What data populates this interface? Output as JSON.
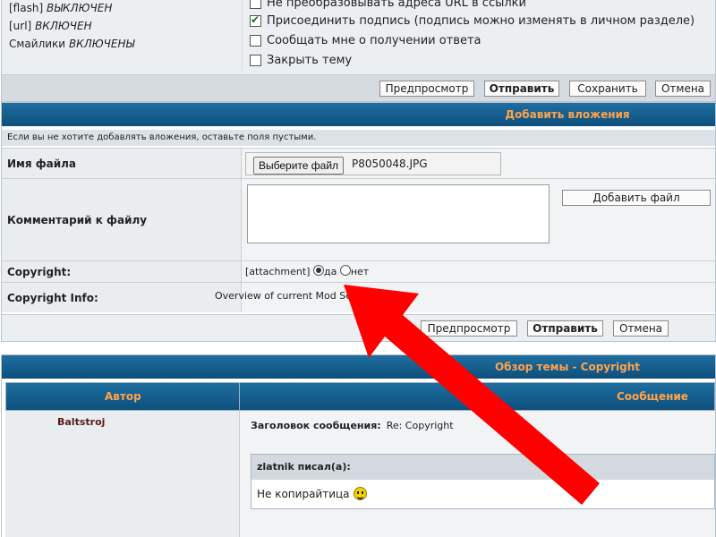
{
  "options": {
    "left_items": [
      {
        "prefix": "[flash]",
        "state": "ВЫКЛЮЧЕН"
      },
      {
        "prefix": "[url]",
        "state": "ВКЛЮЧЕН"
      },
      {
        "prefix": "Смайлики",
        "state": "ВКЛЮЧЕНЫ"
      }
    ],
    "checkboxes": [
      {
        "label": "Не преобразовывать адреса URL в ссылки",
        "checked": false
      },
      {
        "label": "Присоединить подпись (подпись можно изменять в личном разделе)",
        "checked": true
      },
      {
        "label": "Сообщать мне о получении ответа",
        "checked": false
      },
      {
        "label": "Закрыть тему",
        "checked": false
      }
    ],
    "buttons": {
      "preview": "Предпросмотр",
      "submit": "Отправить",
      "save": "Сохранить",
      "cancel": "Отмена"
    }
  },
  "attachments": {
    "title": "Добавить вложения",
    "note": "Если вы не хотите добавлять вложения, оставьте поля пустыми.",
    "filename_label": "Имя файла",
    "choose_file": "Выберите файл",
    "file_value": "P8050048.JPG",
    "comment_label": "Комментарий к файлу",
    "add_file": "Добавить файл",
    "copyright_label": "Copyright:",
    "copyright_tag": "[attachment]",
    "radio_yes": "да",
    "radio_no": "нет",
    "copyright_info_label": "Copyright Info:",
    "copyright_info_value": "Overview of current Mod       Settings",
    "buttons": {
      "preview": "Предпросмотр",
      "submit": "Отправить",
      "cancel": "Отмена"
    }
  },
  "review": {
    "title": "Обзор темы - Copyright",
    "col_author": "Автор",
    "col_message": "Сообщение",
    "author": "Baltstroj",
    "subject_label": "Заголовок сообщения:",
    "subject_value": "Re: Copyright",
    "quote_author": "zlatnik писал(а):",
    "quote_text": "Не копирайтица"
  },
  "colors": {
    "header_bar": "#0d4f7c",
    "header_text": "#ffa34d",
    "arrow": "#ff0000"
  }
}
